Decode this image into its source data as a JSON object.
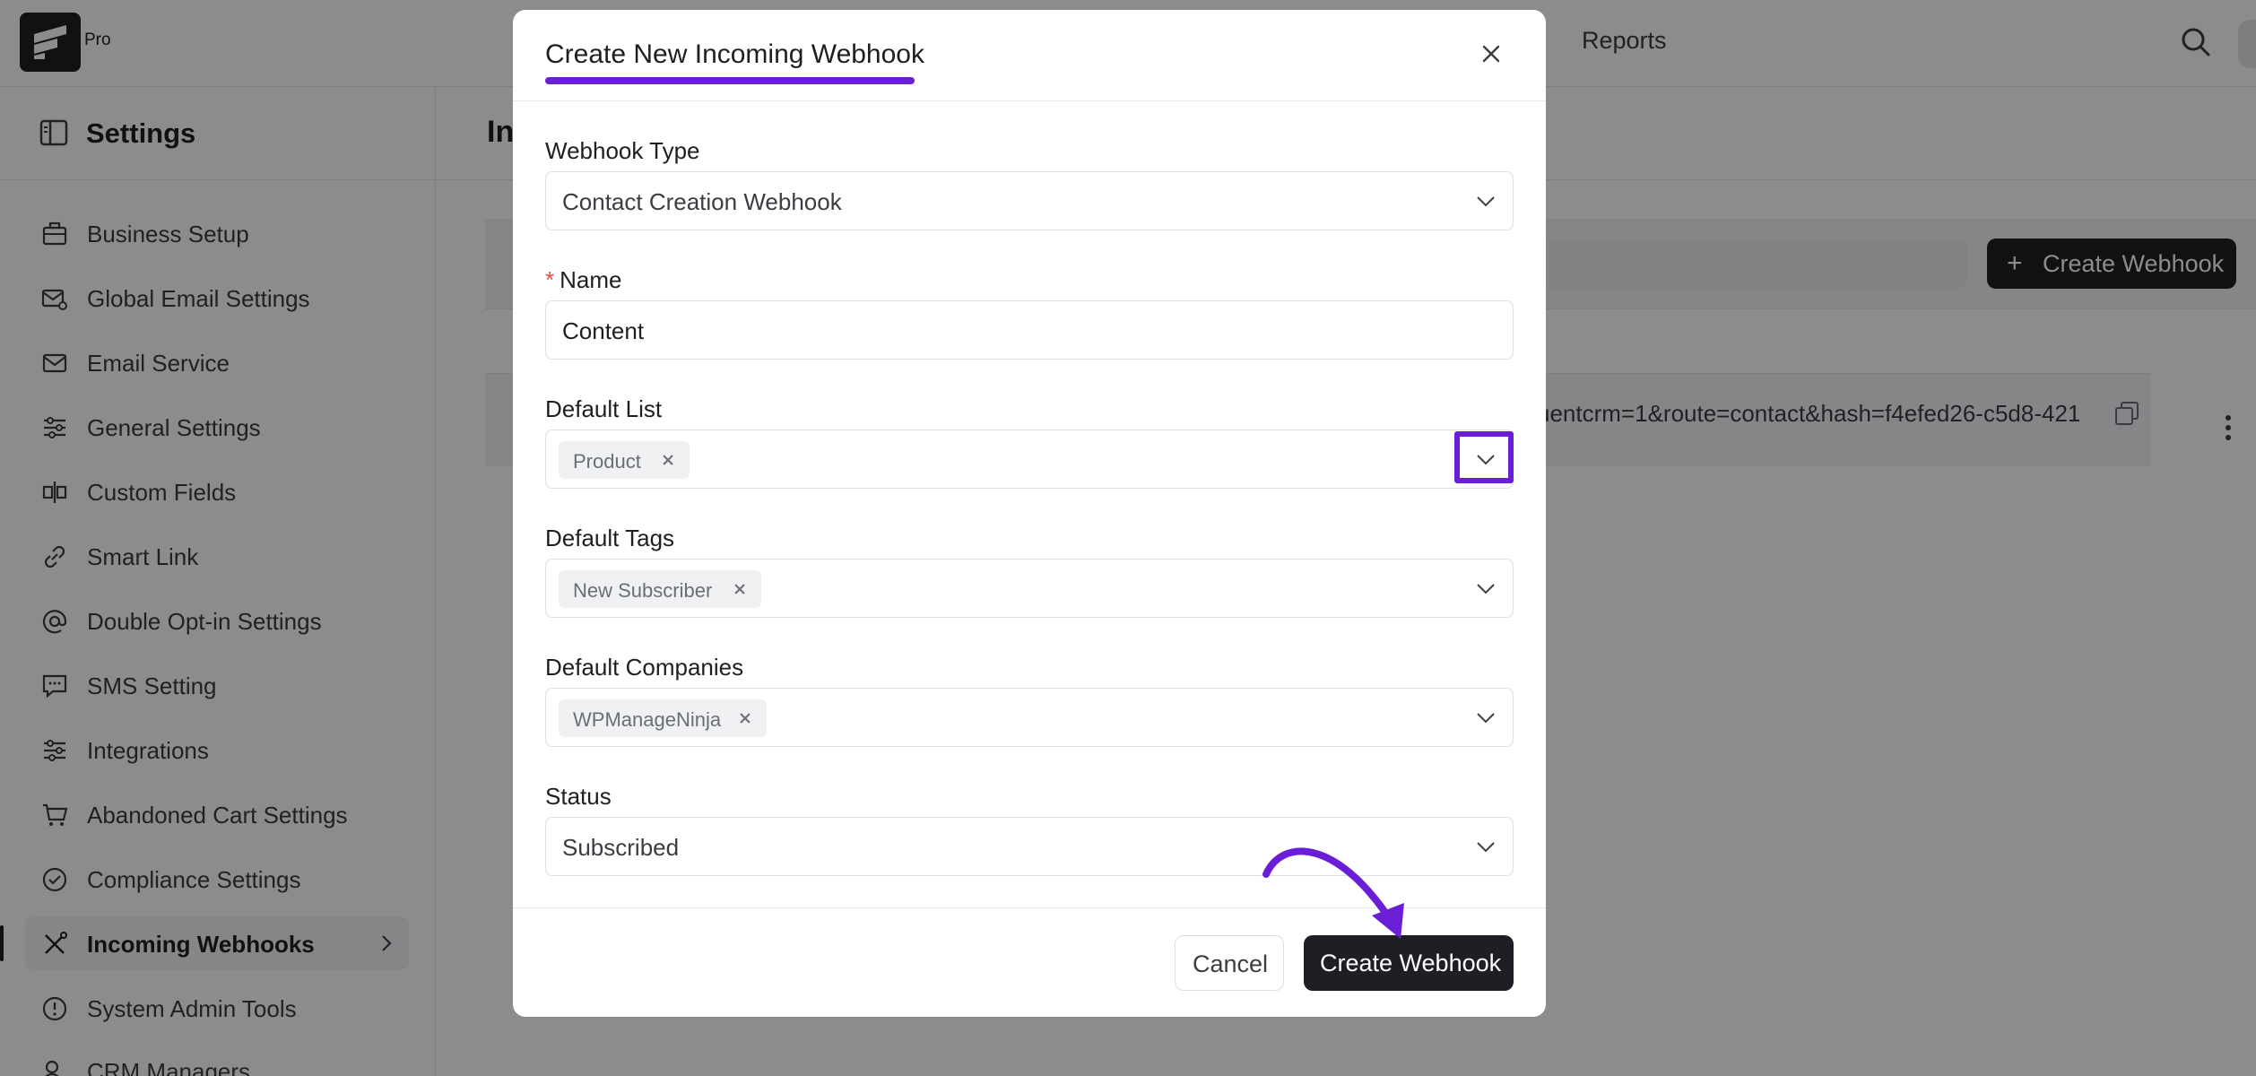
{
  "app": {
    "badge": "Pro",
    "nav_reports": "Reports"
  },
  "sidebar": {
    "title": "Settings",
    "items": [
      {
        "label": "Business Setup",
        "icon": "briefcase-icon"
      },
      {
        "label": "Global Email Settings",
        "icon": "mail-settings-icon"
      },
      {
        "label": "Email Service",
        "icon": "mail-send-icon"
      },
      {
        "label": "General Settings",
        "icon": "sliders-icon"
      },
      {
        "label": "Custom Fields",
        "icon": "custom-fields-icon"
      },
      {
        "label": "Smart Link",
        "icon": "link-icon"
      },
      {
        "label": "Double Opt-in Settings",
        "icon": "at-icon"
      },
      {
        "label": "SMS Setting",
        "icon": "sms-icon"
      },
      {
        "label": "Integrations",
        "icon": "sliders-icon"
      },
      {
        "label": "Abandoned Cart Settings",
        "icon": "cart-icon"
      },
      {
        "label": "Compliance Settings",
        "icon": "check-circle-icon"
      },
      {
        "label": "Incoming Webhooks",
        "icon": "webhook-icon",
        "active": true
      },
      {
        "label": "System Admin Tools",
        "icon": "info-icon"
      },
      {
        "label": "CRM Managers",
        "icon": "users-icon"
      }
    ]
  },
  "main": {
    "title_fragment": "In",
    "create_button": "Create Webhook",
    "row_url": "uentcrm=1&route=contact&hash=f4efed26-c5d8-421"
  },
  "modal": {
    "title": "Create New Incoming Webhook",
    "fields": {
      "webhook_type": {
        "label": "Webhook Type",
        "value": "Contact Creation Webhook"
      },
      "name": {
        "label": "Name",
        "required_mark": "*",
        "value": "Content"
      },
      "default_list": {
        "label": "Default List",
        "tag": "Product"
      },
      "default_tags": {
        "label": "Default Tags",
        "tag": "New Subscriber"
      },
      "default_companies": {
        "label": "Default Companies",
        "tag": "WPManageNinja"
      },
      "status": {
        "label": "Status",
        "value": "Subscribed"
      }
    },
    "cancel_button": "Cancel",
    "create_button": "Create Webhook"
  },
  "colors": {
    "accent": "#6a1fd6",
    "dark_button": "#1d1f24",
    "overlay": "#000000"
  }
}
